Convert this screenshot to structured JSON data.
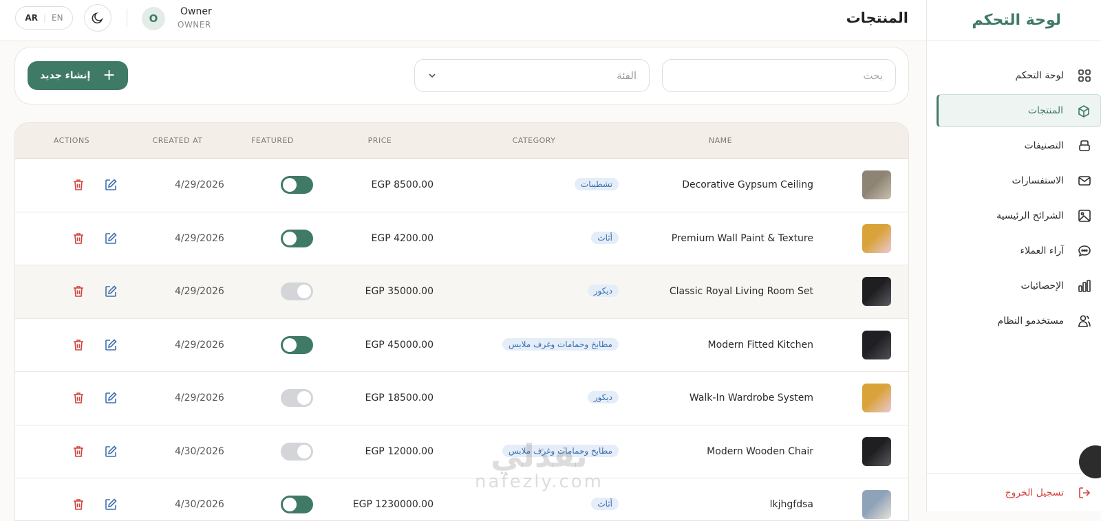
{
  "sidebar": {
    "brand": "لوحة التحكم",
    "items": [
      {
        "label": "لوحة التحكم",
        "icon": "grid-icon"
      },
      {
        "label": "المنتجات",
        "icon": "box-icon",
        "active": true
      },
      {
        "label": "التصنيفات",
        "icon": "layers-icon"
      },
      {
        "label": "الاستفسارات",
        "icon": "mail-icon"
      },
      {
        "label": "الشرائح الرئيسية",
        "icon": "image-icon"
      },
      {
        "label": "آراء العملاء",
        "icon": "chat-icon"
      },
      {
        "label": "الإحصائيات",
        "icon": "bar-chart-icon"
      },
      {
        "label": "مستخدمو النظام",
        "icon": "users-icon"
      }
    ],
    "logout": "تسجيل الخروج"
  },
  "header": {
    "title": "المنتجات",
    "lang_ar": "AR",
    "lang_en": "EN",
    "user_initial": "O",
    "user_name": "Owner",
    "user_role": "OWNER"
  },
  "filters": {
    "search_placeholder": "بحث",
    "category_placeholder": "الفئة",
    "create_label": "إنشاء جديد"
  },
  "table": {
    "columns": [
      "NAME",
      "CATEGORY",
      "PRICE",
      "FEATURED",
      "CREATED AT",
      "ACTIONS"
    ],
    "rows": [
      {
        "name": "Decorative Gypsum Ceiling",
        "category": "تشطيبات",
        "price": "EGP 8500.00",
        "featured": true,
        "created": "4/29/2026"
      },
      {
        "name": "Premium Wall Paint & Texture",
        "category": "أثاث",
        "price": "EGP 4200.00",
        "featured": true,
        "created": "4/29/2026"
      },
      {
        "name": "Classic Royal Living Room Set",
        "category": "ديكور",
        "price": "EGP 35000.00",
        "featured": false,
        "created": "4/29/2026"
      },
      {
        "name": "Modern Fitted Kitchen",
        "category": "مطابخ وحمامات وغرف ملابس",
        "price": "EGP 45000.00",
        "featured": true,
        "created": "4/29/2026"
      },
      {
        "name": "Walk-In Wardrobe System",
        "category": "ديكور",
        "price": "EGP 18500.00",
        "featured": false,
        "created": "4/29/2026"
      },
      {
        "name": "Modern Wooden Chair",
        "category": "مطابخ وحمامات وغرف ملابس",
        "price": "EGP 12000.00",
        "featured": false,
        "created": "4/30/2026"
      },
      {
        "name": "lkjhgfdsa",
        "category": "أثاث",
        "price": "EGP 1230000.00",
        "featured": true,
        "created": "4/30/2026"
      }
    ]
  },
  "watermark": {
    "ar": "نفذلي",
    "en": "nafezly.com"
  },
  "colors": {
    "accent": "#3f7a67",
    "danger": "#d0453d",
    "link": "#3d6fb0"
  }
}
